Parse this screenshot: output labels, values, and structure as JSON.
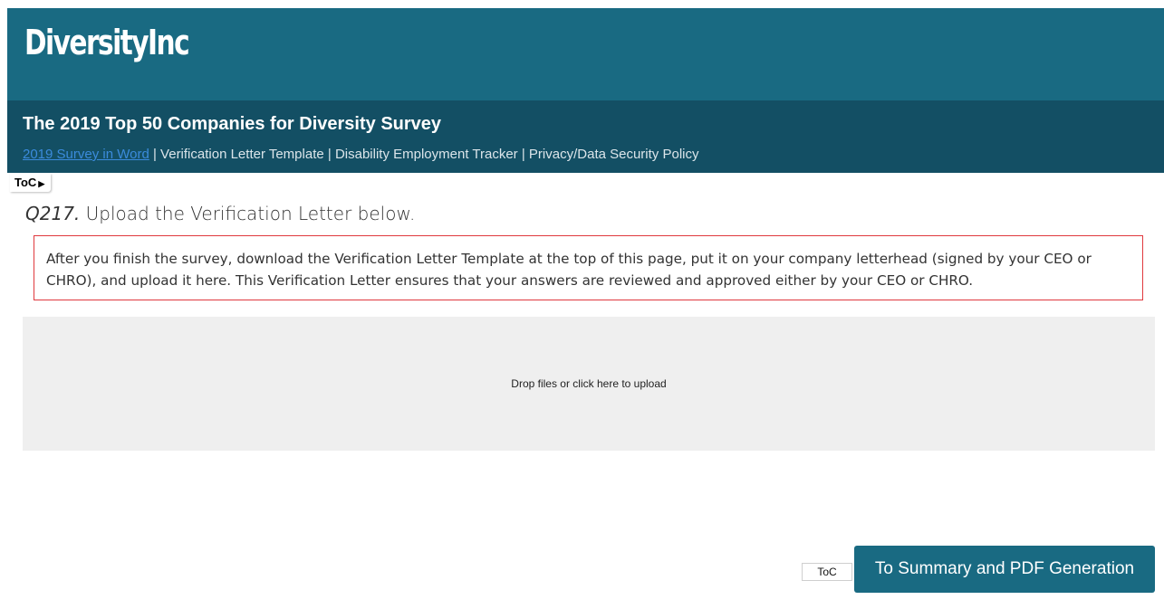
{
  "header": {
    "logo_text": "DiversityInc",
    "survey_title": "The 2019 Top 50 Companies for Diversity Survey",
    "links": {
      "survey_word": "2019 Survey in Word",
      "sep1": " | ",
      "verification_letter": "Verification Letter Template",
      "sep2": " | ",
      "disability_tracker": "Disability Employment Tracker",
      "sep3": " | ",
      "privacy_policy": "Privacy/Data Security Policy"
    }
  },
  "toc_tab": {
    "label": "ToC",
    "arrow": "▶"
  },
  "question": {
    "number": "Q217.",
    "text": " Upload the Verification Letter below."
  },
  "notice": {
    "text": "After you finish the survey, download the Verification Letter Template at the top of this page, put it on your company letterhead (signed by your CEO or CHRO), and upload it here. This Verification Letter ensures that your answers are reviewed and approved either by your CEO or CHRO.",
    "border_color": "#e0393e"
  },
  "upload": {
    "prompt": "Drop files or click here to upload"
  },
  "footer": {
    "toc_button": "ToC",
    "next_button": "To Summary and PDF Generation"
  },
  "colors": {
    "header_bg": "#196a82",
    "title_bar_bg": "#134f64",
    "link": "#3b8bdc"
  }
}
